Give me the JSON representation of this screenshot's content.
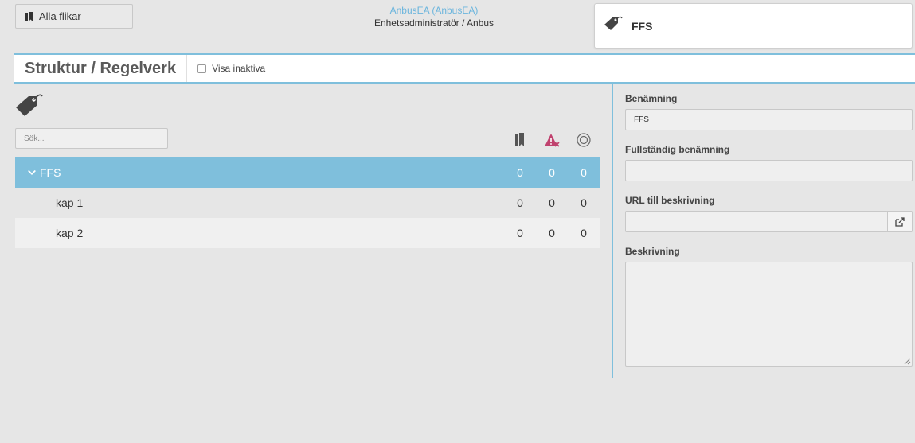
{
  "topbar": {
    "all_tabs_label": "Alla flikar",
    "user_name": "AnbusEA (AnbusEA)",
    "user_role": "Enhetsadministratör / Anbus",
    "card_title": "FFS"
  },
  "titlebar": {
    "title": "Struktur / Regelverk",
    "show_inactive_label": "Visa inaktiva"
  },
  "search": {
    "placeholder": "Sök..."
  },
  "columns": [
    "bookmark-icon",
    "warning-icon",
    "target-icon"
  ],
  "tree": [
    {
      "label": "FFS",
      "counts": [
        "0",
        "0",
        "0"
      ],
      "selected": true,
      "expanded": true
    },
    {
      "label": "kap 1",
      "counts": [
        "0",
        "0",
        "0"
      ]
    },
    {
      "label": "kap 2",
      "counts": [
        "0",
        "0",
        "0"
      ]
    }
  ],
  "details": {
    "name_label": "Benämning",
    "name_value": "FFS",
    "full_name_label": "Fullständig benämning",
    "full_name_value": "",
    "url_label": "URL till beskrivning",
    "url_value": "",
    "description_label": "Beskrivning",
    "description_value": ""
  },
  "colors": {
    "accent": "#7fbfdc",
    "user_link": "#6bb5dd",
    "warning": "#c0426e"
  }
}
